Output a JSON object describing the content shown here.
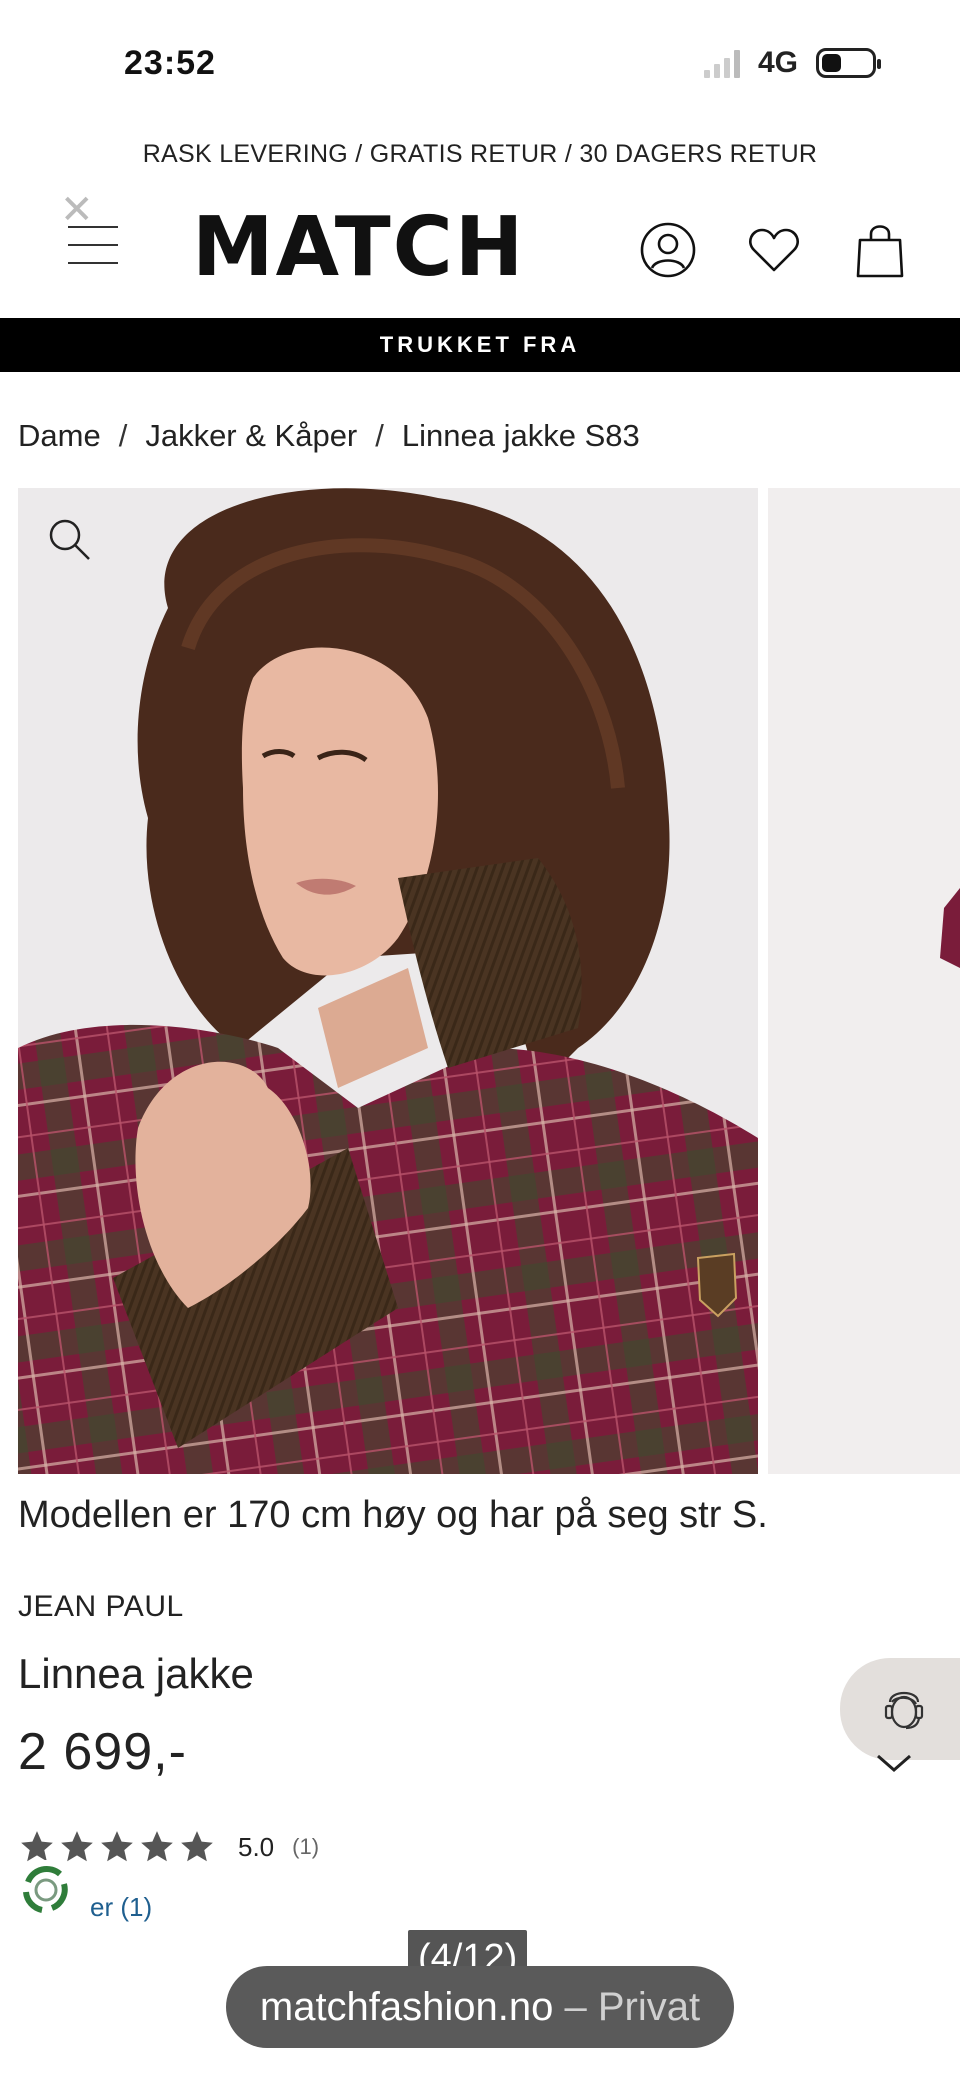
{
  "status_bar": {
    "time": "23:52",
    "network": "4G",
    "battery_level": 0.4
  },
  "promo": {
    "text": "RASK LEVERING / GRATIS RETUR / 30 DAGERS RETUR"
  },
  "header": {
    "logo": "MATCH",
    "icons": [
      "menu-icon",
      "user-icon",
      "heart-icon",
      "bag-icon"
    ]
  },
  "banner": {
    "text": "TRUKKET FRA"
  },
  "breadcrumb": {
    "items": [
      "Dame",
      "Jakker & Kåper",
      "Linnea jakke S83"
    ],
    "separator": "/"
  },
  "gallery": {
    "zoom_icon": "search-icon"
  },
  "product": {
    "model_note": "Modellen er 170 cm høy og har på seg str S.",
    "brand": "JEAN PAUL",
    "name": "Linnea jakke",
    "price": "2 699,-",
    "rating": {
      "stars": 5,
      "score": "5.0",
      "count": "(1)"
    },
    "reviews_link": "er (1)"
  },
  "chat": {
    "icon": "support-agent-icon"
  },
  "browser": {
    "image_counter": "(4/12)",
    "domain": "matchfashion.no",
    "mode": " – Privat"
  },
  "colors": {
    "banner_bg": "#000000",
    "link": "#1f5f8f",
    "chat_bg": "#e3dfdc",
    "url_pill": "#5a5a5a"
  }
}
